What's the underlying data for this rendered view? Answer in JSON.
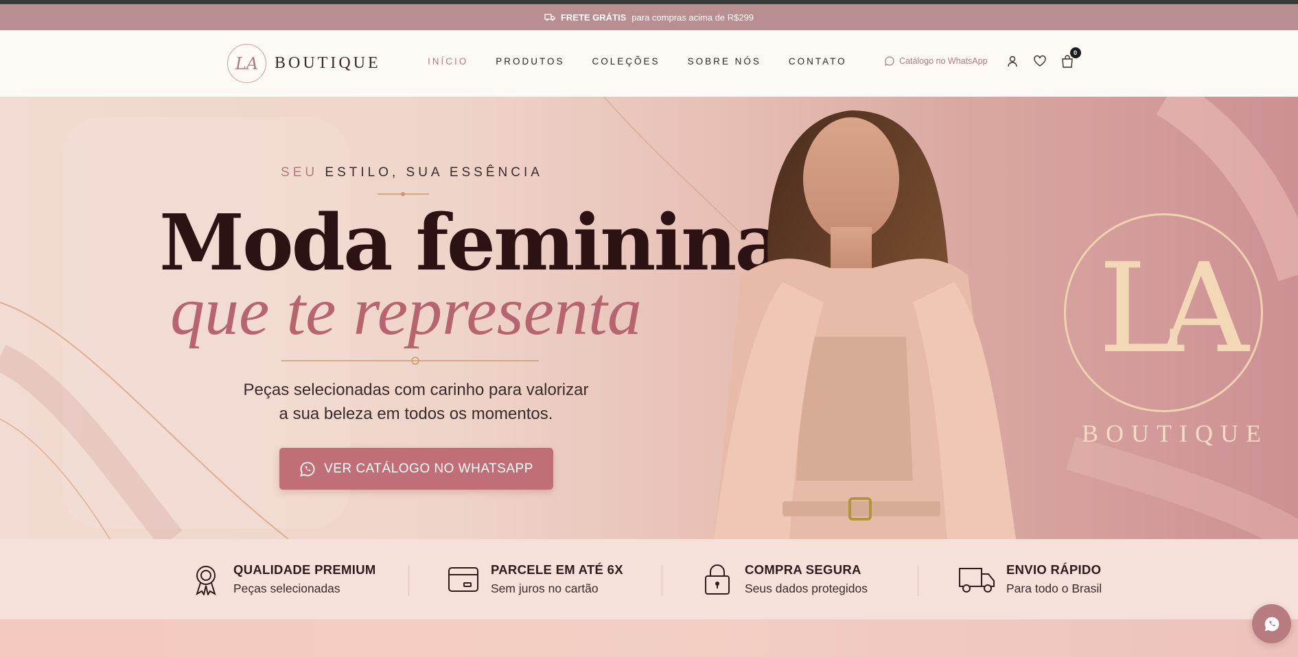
{
  "announcement": {
    "bold": "FRETE GRÁTIS",
    "text": "para compras acima de R$299"
  },
  "brand": {
    "monogram": "LA",
    "name": "BOUTIQUE"
  },
  "nav": [
    {
      "label": "INÍCIO",
      "active": true
    },
    {
      "label": "PRODUTOS"
    },
    {
      "label": "COLEÇÕES"
    },
    {
      "label": "SOBRE NÓS"
    },
    {
      "label": "CONTATO"
    }
  ],
  "header_actions": {
    "whatsapp_label": "Catálogo no WhatsApp",
    "cart_count": "0"
  },
  "hero": {
    "eyebrow_accent": "SEU",
    "eyebrow_rest": "ESTILO, SUA ESSÊNCIA",
    "title_line1": "Moda feminina",
    "title_line2": "que te representa",
    "subtitle_line1": "Peças selecionadas com carinho para valorizar",
    "subtitle_line2": "a sua beleza em todos os momentos.",
    "cta_label": "VER CATÁLOGO NO WHATSAPP",
    "badge_letters": "LA",
    "badge_word": "BOUTIQUE"
  },
  "features": [
    {
      "title": "QUALIDADE PREMIUM",
      "subtitle": "Peças selecionadas",
      "icon": "award-icon"
    },
    {
      "title": "PARCELE EM ATÉ 6X",
      "subtitle": "Sem juros no cartão",
      "icon": "credit-card-icon"
    },
    {
      "title": "COMPRA SEGURA",
      "subtitle": "Seus dados protegidos",
      "icon": "lock-icon"
    },
    {
      "title": "ENVIO RÁPIDO",
      "subtitle": "Para todo o Brasil",
      "icon": "truck-icon"
    }
  ],
  "colors": {
    "accent": "#c06f78",
    "announce_bg": "#b88e91",
    "text_dark": "#2c1212"
  }
}
